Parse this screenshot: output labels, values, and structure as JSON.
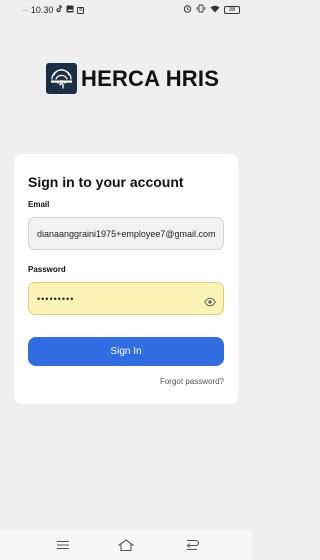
{
  "status_bar": {
    "signal": ".....",
    "time": "10.30",
    "app_icon_b": "B",
    "battery": "38"
  },
  "brand": {
    "name": "HERCA HRIS"
  },
  "login": {
    "title": "Sign in to your account",
    "email_label": "Email",
    "email_value": "dianaanggraini1975+employee7@gmail.com",
    "password_label": "Password",
    "password_value": "•••••••••",
    "sign_in_label": "Sign In",
    "forgot_label": "Forgot password?"
  },
  "colors": {
    "primary": "#2f6de1",
    "password_autofill_bg": "#fbf4b4",
    "background": "#efefef",
    "logo_bg": "#1d2f43"
  },
  "icons": {
    "status": [
      "tiktok-icon",
      "image-icon",
      "b-app-icon",
      "alarm-icon",
      "vibrate-icon",
      "wifi-icon",
      "battery-icon"
    ],
    "password_toggle": "eye-icon",
    "nav": [
      "menu-icon",
      "home-icon",
      "back-icon"
    ]
  }
}
